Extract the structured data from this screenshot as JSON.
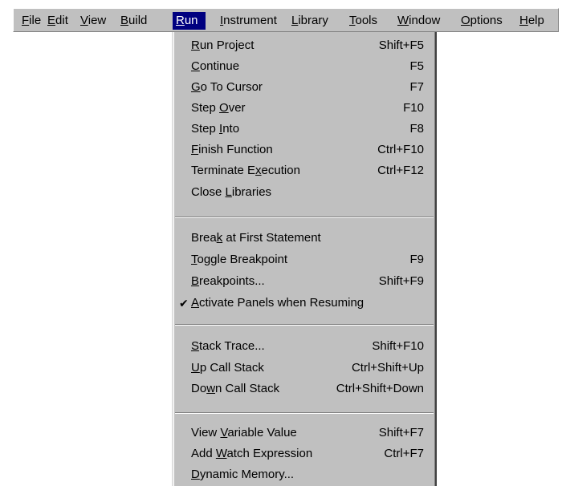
{
  "menubar": {
    "items": [
      {
        "pre": "",
        "acc": "F",
        "post": "ile"
      },
      {
        "pre": "",
        "acc": "E",
        "post": "dit"
      },
      {
        "pre": "",
        "acc": "V",
        "post": "iew"
      },
      {
        "pre": "",
        "acc": "B",
        "post": "uild"
      },
      {
        "pre": "",
        "acc": "R",
        "post": "un"
      },
      {
        "pre": "",
        "acc": "I",
        "post": "nstrument"
      },
      {
        "pre": "",
        "acc": "L",
        "post": "ibrary"
      },
      {
        "pre": "",
        "acc": "T",
        "post": "ools"
      },
      {
        "pre": "",
        "acc": "W",
        "post": "indow"
      },
      {
        "pre": "",
        "acc": "O",
        "post": "ptions"
      },
      {
        "pre": "",
        "acc": "H",
        "post": "elp"
      }
    ]
  },
  "run_menu": {
    "items": [
      {
        "pre": "",
        "acc": "R",
        "post": "un Project",
        "shortcut": "Shift+F5"
      },
      {
        "pre": "",
        "acc": "C",
        "post": "ontinue",
        "shortcut": "F5"
      },
      {
        "pre": "",
        "acc": "G",
        "post": "o To Cursor",
        "shortcut": "F7"
      },
      {
        "pre": "Step ",
        "acc": "O",
        "post": "ver",
        "shortcut": "F10"
      },
      {
        "pre": "Step ",
        "acc": "I",
        "post": "nto",
        "shortcut": "F8"
      },
      {
        "pre": "",
        "acc": "F",
        "post": "inish Function",
        "shortcut": "Ctrl+F10"
      },
      {
        "pre": "Terminate E",
        "acc": "x",
        "post": "ecution",
        "shortcut": "Ctrl+F12"
      },
      {
        "pre": "Close ",
        "acc": "L",
        "post": "ibraries",
        "shortcut": ""
      },
      {
        "pre": "Brea",
        "acc": "k",
        "post": " at First Statement",
        "shortcut": ""
      },
      {
        "pre": "",
        "acc": "T",
        "post": "oggle Breakpoint",
        "shortcut": "F9"
      },
      {
        "pre": "",
        "acc": "B",
        "post": "reakpoints...",
        "shortcut": "Shift+F9"
      },
      {
        "pre": "",
        "acc": "A",
        "post": "ctivate Panels when Resuming",
        "shortcut": "",
        "check": "✔"
      },
      {
        "pre": "",
        "acc": "S",
        "post": "tack Trace...",
        "shortcut": "Shift+F10"
      },
      {
        "pre": "",
        "acc": "U",
        "post": "p Call Stack",
        "shortcut": "Ctrl+Shift+Up"
      },
      {
        "pre": "Do",
        "acc": "w",
        "post": "n Call Stack",
        "shortcut": "Ctrl+Shift+Down"
      },
      {
        "pre": "View ",
        "acc": "V",
        "post": "ariable Value",
        "shortcut": "Shift+F7"
      },
      {
        "pre": "Add ",
        "acc": "W",
        "post": "atch Expression",
        "shortcut": "Ctrl+F7"
      },
      {
        "pre": "",
        "acc": "D",
        "post": "ynamic Memory...",
        "shortcut": ""
      }
    ]
  }
}
